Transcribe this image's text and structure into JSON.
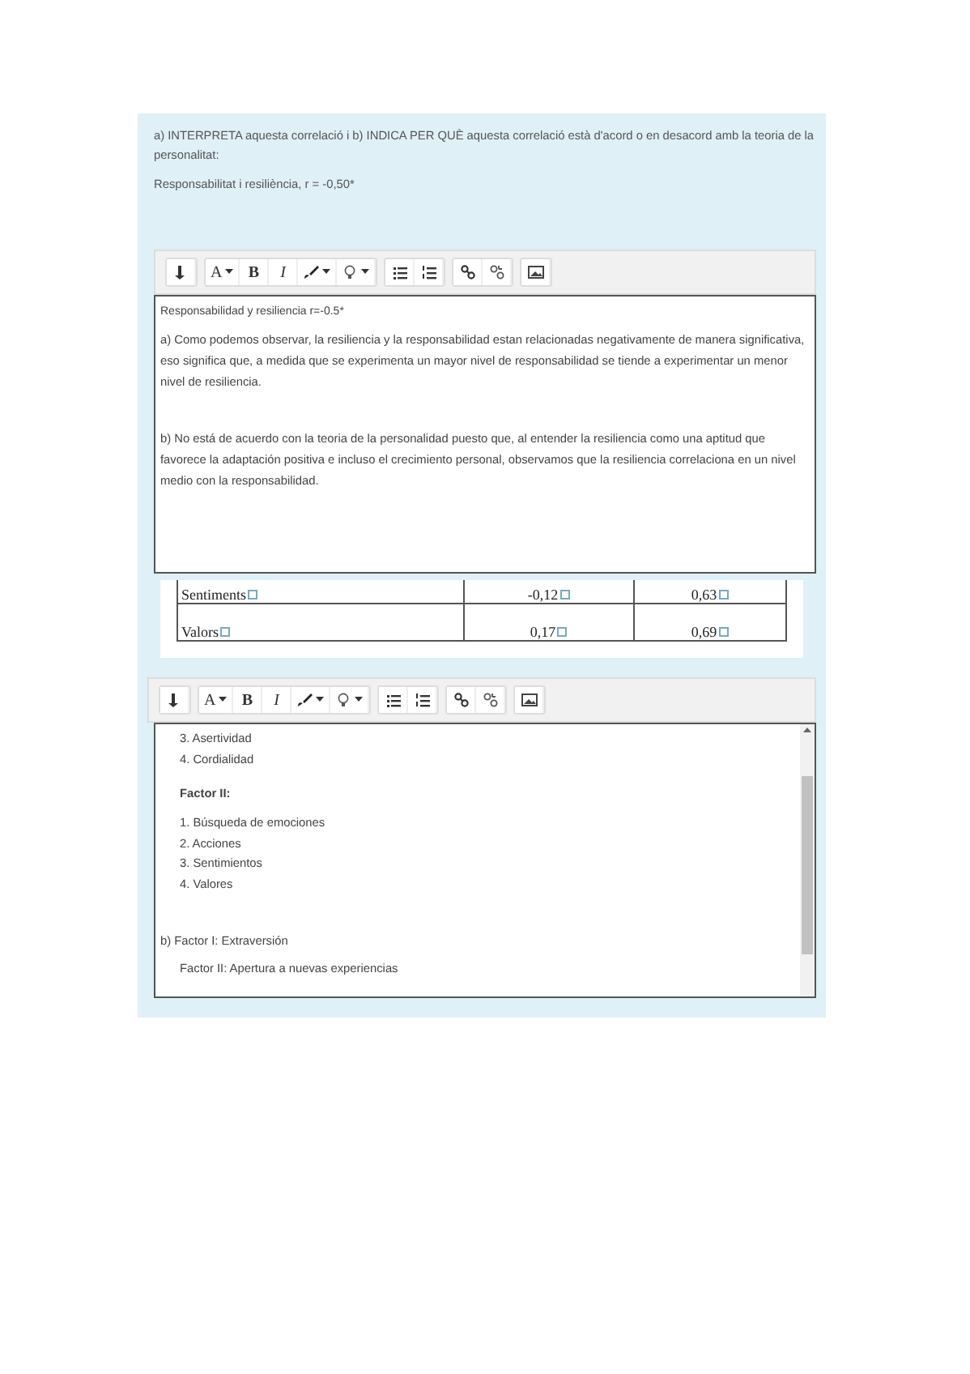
{
  "question": {
    "text": "a) INTERPRETA aquesta correlació i b) INDICA PER QUÈ aquesta correlació està d'acord o en desacord amb la teoria de la personalitat:",
    "formula": "Responsabilitat i resiliència, r = -0,50*"
  },
  "editors": [
    {
      "scrollable": false,
      "toolbar": [
        [
          {
            "kind": "collapse"
          }
        ],
        [
          {
            "kind": "font",
            "label": "A"
          },
          {
            "kind": "bold",
            "label": "B"
          },
          {
            "kind": "italic",
            "label": "I"
          },
          {
            "kind": "brush"
          },
          {
            "kind": "bulb"
          }
        ],
        [
          {
            "kind": "bullets"
          },
          {
            "kind": "numbers"
          }
        ],
        [
          {
            "kind": "link"
          },
          {
            "kind": "unlink"
          }
        ],
        [
          {
            "kind": "image"
          }
        ]
      ],
      "blocks": [
        {
          "kind": "note",
          "text": "Responsabilidad y resiliencia r=-0.5*"
        },
        {
          "kind": "para",
          "text": "a) Como podemos observar, la resiliencia y la responsabilidad estan relacionadas negativamente de manera significativa, eso significa que, a medida que se experimenta un mayor nivel de responsabilidad se tiende a experimentar un menor nivel de resiliencia."
        },
        {
          "kind": "answer",
          "text": "b) No está de acuerdo con la teoria de la personalidad puesto que, al entender la resiliencia como una aptitud que favorece la adaptación positiva e incluso el crecimiento personal, observamos que la resiliencia correlaciona en un nivel medio con la responsabilidad."
        }
      ]
    },
    {
      "scrollable": true,
      "toolbar": [
        [
          {
            "kind": "collapse"
          }
        ],
        [
          {
            "kind": "font",
            "label": "A"
          },
          {
            "kind": "bold",
            "label": "B"
          },
          {
            "kind": "italic",
            "label": "I"
          },
          {
            "kind": "brush"
          },
          {
            "kind": "bulb"
          }
        ],
        [
          {
            "kind": "bullets"
          },
          {
            "kind": "numbers"
          }
        ],
        [
          {
            "kind": "link"
          },
          {
            "kind": "unlink"
          }
        ],
        [
          {
            "kind": "image"
          }
        ]
      ],
      "blocks": [
        {
          "kind": "item",
          "text": "3.   Asertividad"
        },
        {
          "kind": "item",
          "text": "4.   Cordialidad"
        },
        {
          "kind": "heading",
          "text": "Factor II:"
        },
        {
          "kind": "item",
          "text": "1. Búsqueda de emociones"
        },
        {
          "kind": "item",
          "text": "2. Acciones"
        },
        {
          "kind": "item",
          "text": "3. Sentimientos"
        },
        {
          "kind": "item",
          "text": "4. Valores"
        },
        {
          "kind": "answer",
          "text": "b) Factor I: Extraversión"
        },
        {
          "kind": "indent",
          "text": "Factor II: Apertura a nuevas experiencias"
        }
      ]
    }
  ],
  "table": {
    "rows": [
      [
        "Sentiments",
        "-0,12",
        "0,63"
      ],
      [
        "Valors",
        "0,17",
        "0,69"
      ]
    ]
  }
}
